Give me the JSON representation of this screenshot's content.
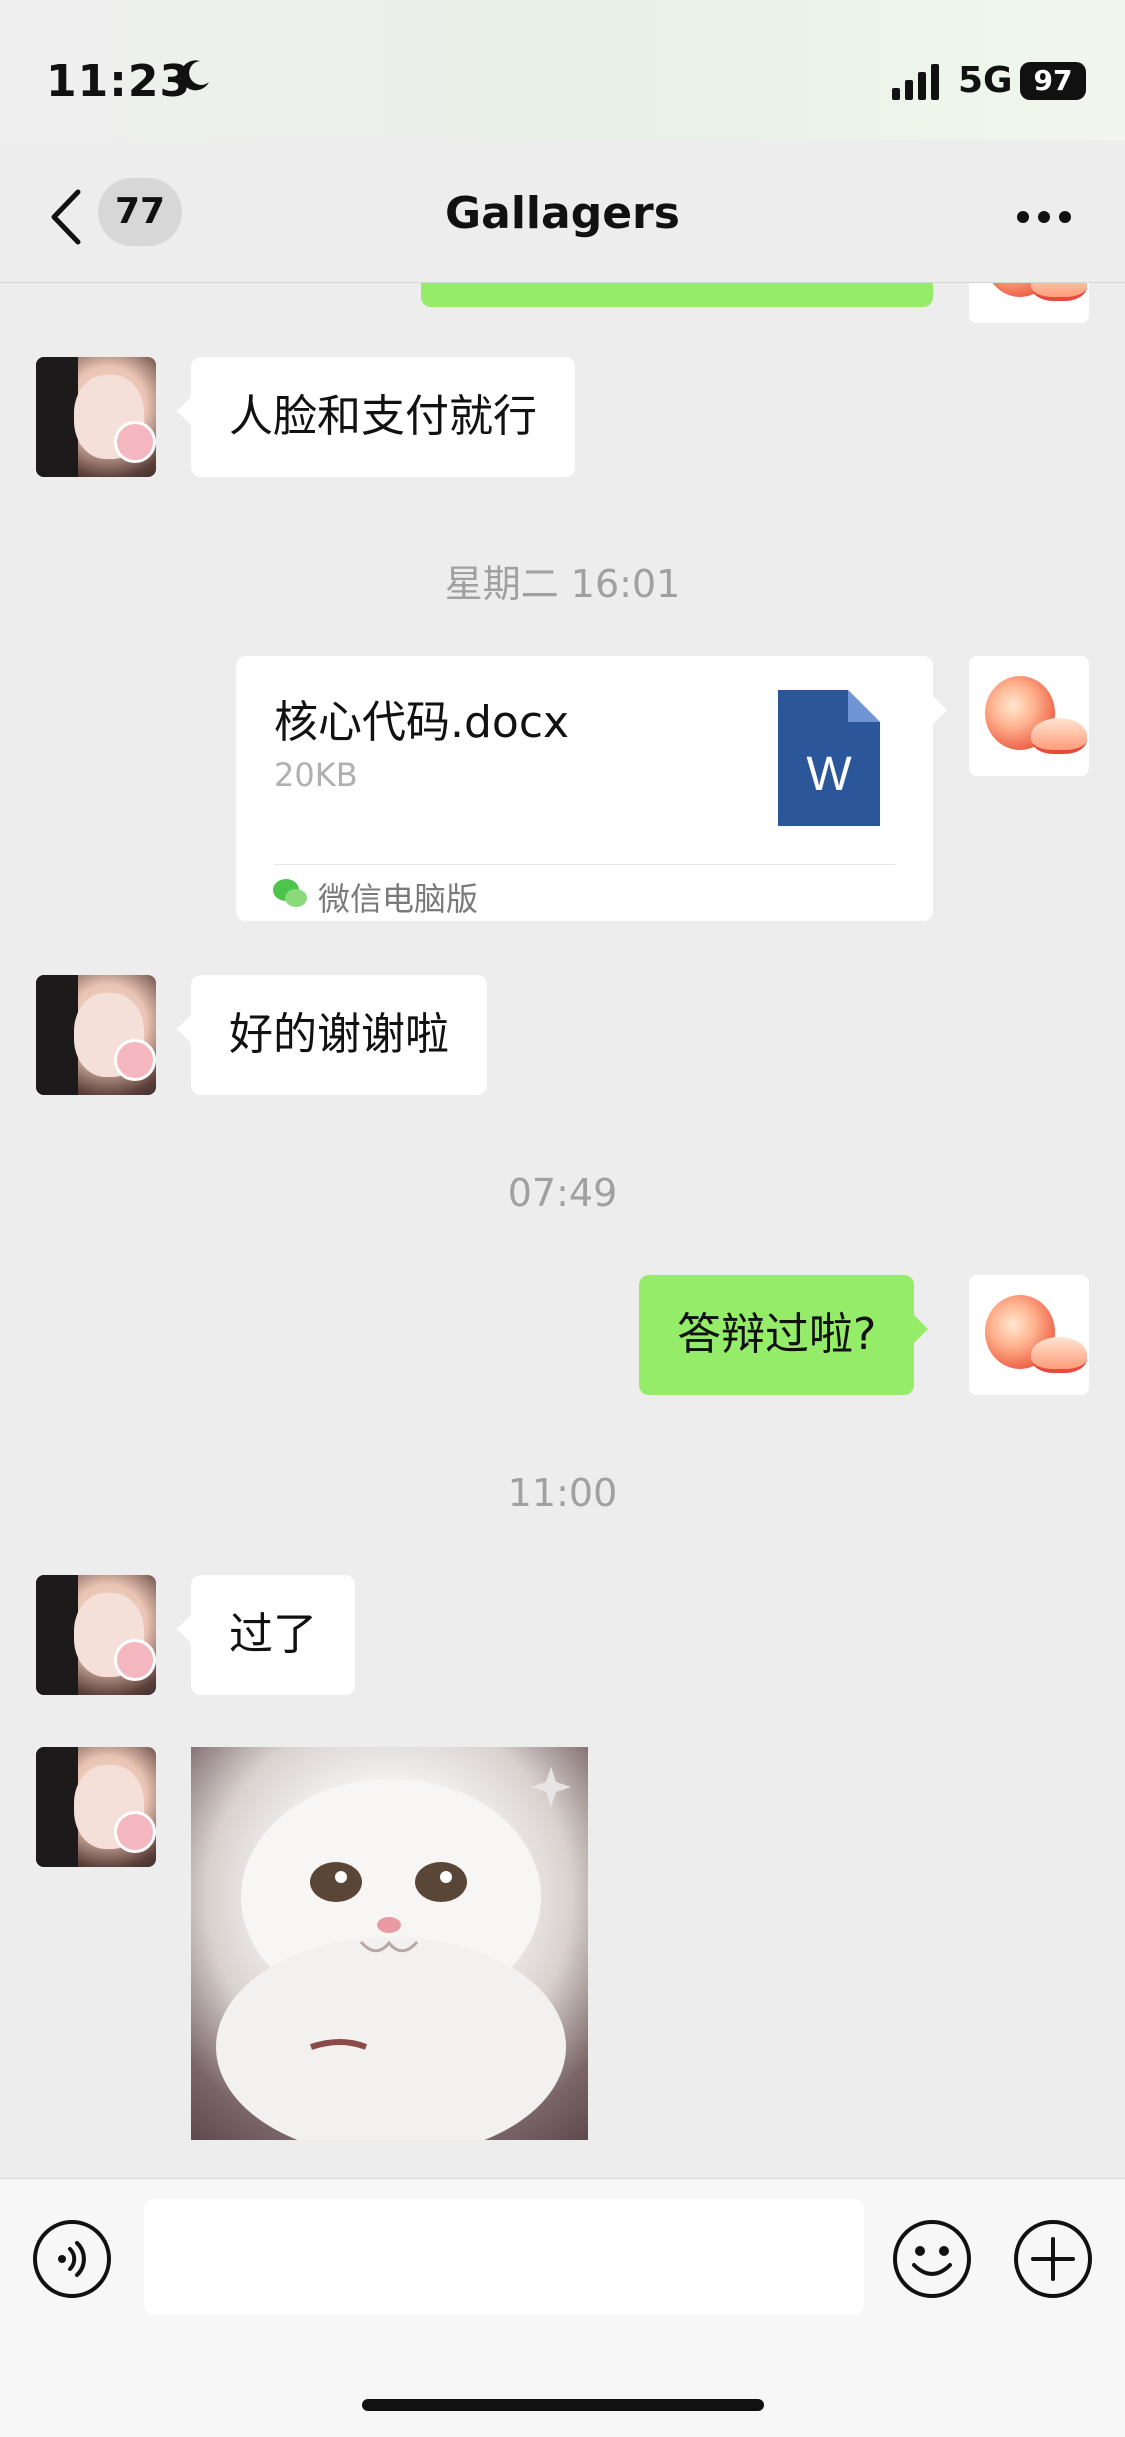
{
  "status_bar": {
    "time": "11:23",
    "network": "5G",
    "battery": "97"
  },
  "nav": {
    "back_count": "77",
    "title": "Gallagers"
  },
  "messages": {
    "m1": "人脸和支付就行",
    "ts1": "星期二 16:01",
    "file": {
      "name": "核心代码.docx",
      "size": "20KB",
      "icon_letter": "W",
      "source": "微信电脑版"
    },
    "m2": "好的谢谢啦",
    "ts2": "07:49",
    "m3": "答辩过啦?",
    "ts3": "11:00",
    "m4": "过了"
  },
  "colors": {
    "background": "#ededed",
    "outgoing_bubble": "#95ec69",
    "incoming_bubble": "#ffffff",
    "word_icon": "#2b579a"
  },
  "icons": {
    "back": "chevron-left-icon",
    "more": "ellipsis-icon",
    "voice": "voice-icon",
    "emoji": "emoji-icon",
    "plus": "plus-icon"
  }
}
